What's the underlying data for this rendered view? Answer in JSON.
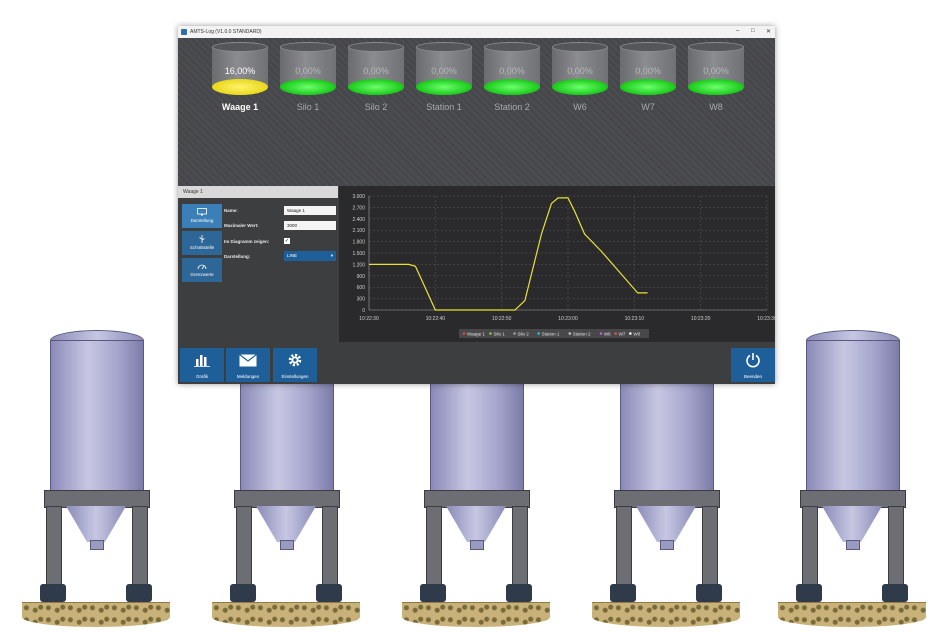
{
  "window": {
    "title": "AMTS-Log (V1.0.0 STANDARD)"
  },
  "tanks": [
    {
      "label": "Waage 1",
      "percent": "16,00%",
      "fill": "yellow",
      "active": true
    },
    {
      "label": "Silo 1",
      "percent": "0,00%",
      "fill": "green",
      "active": false
    },
    {
      "label": "Silo 2",
      "percent": "0,00%",
      "fill": "green",
      "active": false
    },
    {
      "label": "Station 1",
      "percent": "0,00%",
      "fill": "green",
      "active": false
    },
    {
      "label": "Station 2",
      "percent": "0,00%",
      "fill": "green",
      "active": false
    },
    {
      "label": "W6",
      "percent": "0,00%",
      "fill": "green",
      "active": false
    },
    {
      "label": "W7",
      "percent": "0,00%",
      "fill": "green",
      "active": false
    },
    {
      "label": "W8",
      "percent": "0,00%",
      "fill": "green",
      "active": false
    }
  ],
  "panel": {
    "header": "Waage 1",
    "buttons": [
      {
        "label": "Darstellung",
        "icon": "monitor-icon"
      },
      {
        "label": "Schnittstelle",
        "icon": "usb-icon"
      },
      {
        "label": "Grenzwerte",
        "icon": "gauge-icon"
      }
    ],
    "fields": {
      "name_label": "Name:",
      "name_value": "Waage 1",
      "max_label": "Maximaler Wert:",
      "max_value": "3000",
      "diagram_label": "Im Diagramm zeigen:",
      "diagram_checked": "✓",
      "display_label": "Darstellung:",
      "display_value": "LINE"
    }
  },
  "chart_data": {
    "type": "line",
    "x_ticks": [
      "10:22:30",
      "10:22:40",
      "10:22:50",
      "10:23:00",
      "10:23:10",
      "10:23:20",
      "10:23:30"
    ],
    "y_ticks": [
      "0",
      "300",
      "600",
      "900",
      "1.200",
      "1.500",
      "1.800",
      "2.100",
      "2.400",
      "2.700",
      "3.000"
    ],
    "ylim": [
      0,
      3000
    ],
    "xlim_seconds": [
      0,
      60
    ],
    "grid": true,
    "series": [
      {
        "name": "Waage 1",
        "color": "#e8e233",
        "x": [
          0,
          6,
          7,
          10,
          22,
          23.5,
          26,
          27.5,
          28.5,
          30,
          31,
          32.5,
          35,
          38,
          40.5,
          42
        ],
        "y": [
          1200,
          1200,
          1150,
          0,
          0,
          250,
          2000,
          2800,
          2950,
          2950,
          2600,
          2000,
          1550,
          950,
          450,
          450
        ]
      }
    ],
    "legend": [
      "Waage 1",
      "Silo 1",
      "Silo 2",
      "Station 1",
      "Station 2",
      "W6",
      "W7",
      "W8"
    ],
    "legend_colors": [
      "#e24b4b",
      "#8bc34a",
      "#9e9e9e",
      "#26c6da",
      "#bdbdbd",
      "#ba68c8",
      "#ef5350",
      "#fafafa"
    ],
    "legend_position": "bottom"
  },
  "bottom_buttons": [
    {
      "label": "Grafik",
      "icon": "chart-icon"
    },
    {
      "label": "Meldungen",
      "icon": "mail-icon"
    },
    {
      "label": "Einstellungen",
      "icon": "gear-icon"
    },
    {
      "label": "Beenden",
      "icon": "power-icon"
    }
  ]
}
